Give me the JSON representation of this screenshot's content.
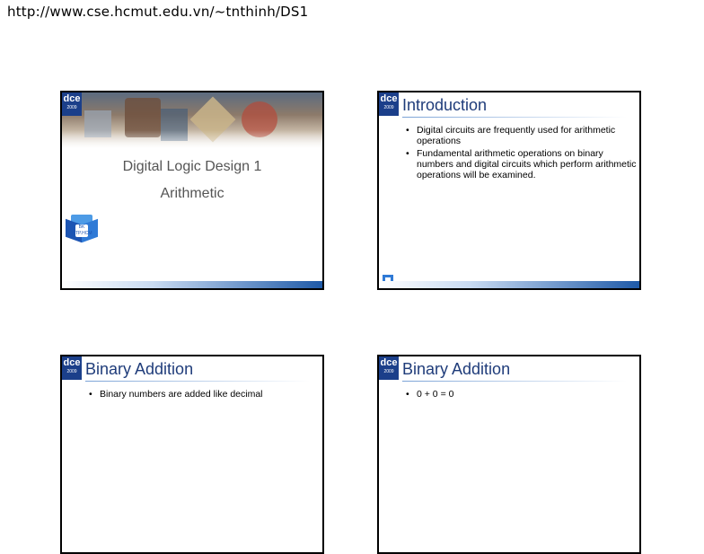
{
  "url": "http://www.cse.hcmut.edu.vn/~tnthinh/DS1",
  "slides": {
    "title_slide": {
      "logo": "dce",
      "logo_sub": "2009",
      "course": "Digital Logic Design 1",
      "subtitle": "Arithmetic",
      "badge_text": "BK\nTP.HCM"
    },
    "intro": {
      "logo": "dce",
      "logo_sub": "2009",
      "title": "Introduction",
      "bullets": [
        "Digital circuits are frequently used for arithmetic operations",
        "Fundamental arithmetic operations on binary numbers and digital circuits which perform arithmetic operations will be examined."
      ]
    },
    "binary_addition_1": {
      "logo": "dce",
      "logo_sub": "2009",
      "title": "Binary Addition",
      "bullets": [
        "Binary numbers are added like decimal"
      ]
    },
    "binary_addition_2": {
      "logo": "dce",
      "logo_sub": "2009",
      "title": "Binary Addition",
      "bullets": [
        "0 + 0 = 0"
      ]
    }
  },
  "icons": [
    "dce-logo-icon",
    "bk-cube-icon"
  ],
  "colors": {
    "accent": "#1f4f9a",
    "title": "#1f3c7a"
  }
}
